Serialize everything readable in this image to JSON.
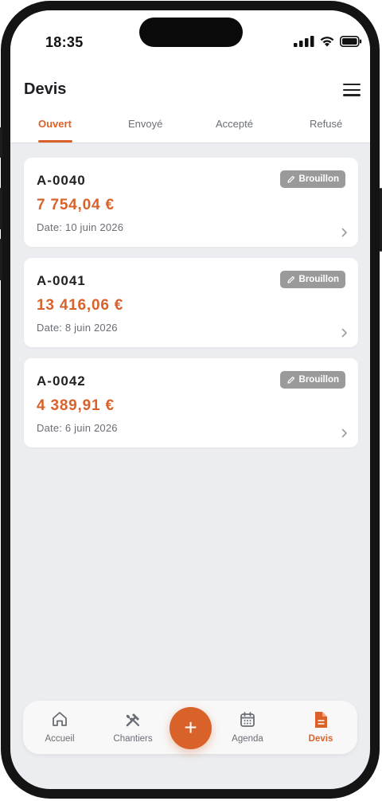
{
  "status_bar": {
    "time": "18:35"
  },
  "header": {
    "title": "Devis"
  },
  "tabs": [
    {
      "label": "Ouvert",
      "active": true
    },
    {
      "label": "Envoyé",
      "active": false
    },
    {
      "label": "Accepté",
      "active": false
    },
    {
      "label": "Refusé",
      "active": false
    }
  ],
  "quotes": [
    {
      "number": "A-0040",
      "amount": "7 754,04 €",
      "date": "Date: 10 juin 2026",
      "status": "Brouillon"
    },
    {
      "number": "A-0041",
      "amount": "13 416,06 €",
      "date": "Date: 8 juin 2026",
      "status": "Brouillon"
    },
    {
      "number": "A-0042",
      "amount": "4 389,91 €",
      "date": "Date: 6 juin 2026",
      "status": "Brouillon"
    }
  ],
  "bottom_nav": {
    "items": [
      {
        "label": "Accueil",
        "icon": "home-icon"
      },
      {
        "label": "Chantiers",
        "icon": "tools-icon"
      },
      {
        "label": "Agenda",
        "icon": "calendar-icon"
      },
      {
        "label": "Devis",
        "icon": "document-icon",
        "active": true
      }
    ],
    "fab_label": "+"
  },
  "colors": {
    "accent": "#d9622b",
    "badge": "#9a9a9a",
    "background": "#ecedf0"
  }
}
